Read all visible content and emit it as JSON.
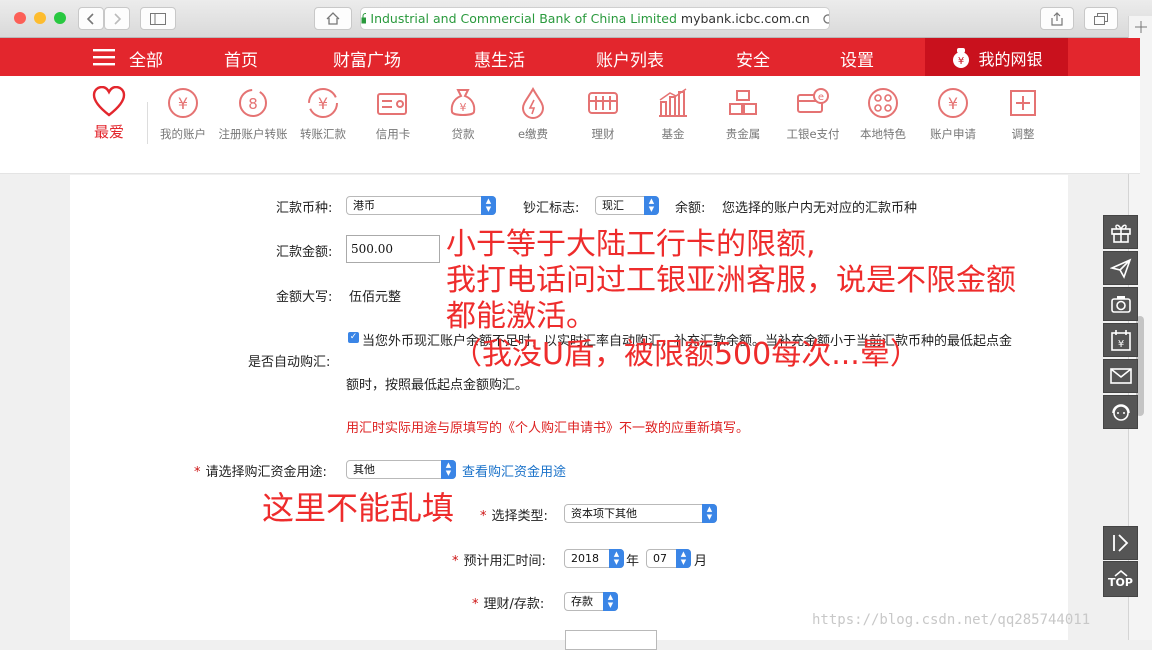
{
  "browser": {
    "url_org": "Industrial and Commercial Bank of China Limited",
    "url_domain": "mybank.icbc.com.cn"
  },
  "nav": {
    "all_label": "全部",
    "items": [
      "首页",
      "财富广场",
      "惠生活",
      "账户列表",
      "安全",
      "设置"
    ],
    "mybank_label": "我的网银"
  },
  "icons": {
    "favorite": "最爱",
    "items": [
      "我的账户",
      "注册账户转账",
      "转账汇款",
      "信用卡",
      "贷款",
      "e缴费",
      "理财",
      "基金",
      "贵金属",
      "工银e支付",
      "本地特色",
      "账户申请",
      "调整"
    ]
  },
  "form": {
    "currency_label": "汇款币种:",
    "currency_value": "港币",
    "cash_flag_label": "钞汇标志:",
    "cash_flag_value": "现汇",
    "balance_label": "余额:",
    "balance_text": "您选择的账户内无对应的汇款币种",
    "amount_label": "汇款金额:",
    "amount_value": "500.00",
    "amount_caps_label": "金额大写:",
    "amount_caps_value": "伍佰元整",
    "auto_buy_label": "是否自动购汇:",
    "auto_buy_text_1": "当您外币现汇账户余额不足时，以实时汇率自动购汇，补充汇款余额。当补充金额小于当前汇款币种的最低起点金",
    "auto_buy_text_2": "额时，按照最低起点金额购汇。",
    "notice": "用汇时实际用途与原填写的《个人购汇申请书》不一致的应重新填写。",
    "purpose_label": "请选择购汇资金用途:",
    "purpose_value": "其他",
    "purpose_link": "查看购汇资金用途",
    "type_label": "选择类型:",
    "type_value": "资本项下其他",
    "date_label": "预计用汇时间:",
    "year_value": "2018",
    "year_unit": "年",
    "month_value": "07",
    "month_unit": "月",
    "finance_label": "理财/存款:",
    "finance_value": "存款"
  },
  "annotations": {
    "line1": "小于等于大陆工行卡的限额,",
    "line2": "我打电话问过工银亚洲客服，说是不限金额",
    "line3": "都能激活。",
    "line4": "（我没U盾，被限额500每次...晕）",
    "line5": "这里不能乱填"
  },
  "side_toolbar": {
    "top_label": "TOP"
  },
  "watermark": "https://blog.csdn.net/qq285744011",
  "colors": {
    "brand_red": "#e3262d",
    "annotation_red": "#ee2c2c",
    "link_blue": "#1a72c9"
  }
}
